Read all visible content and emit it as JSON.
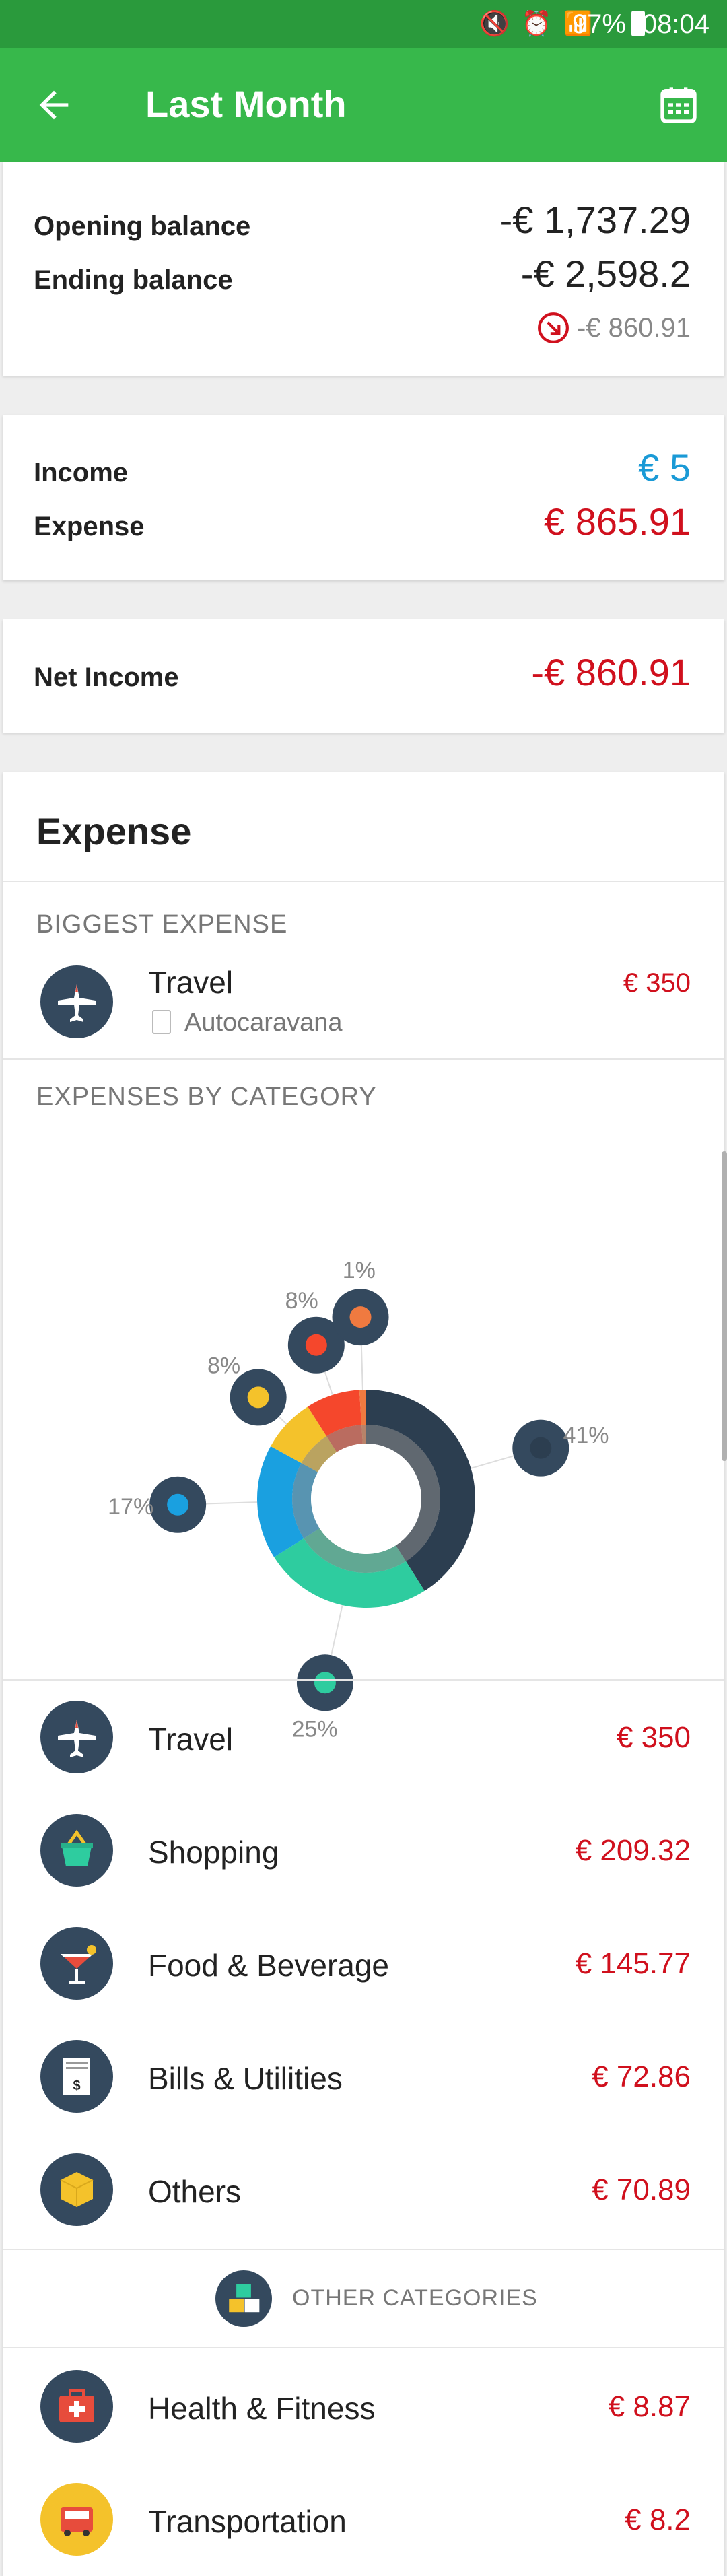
{
  "status_bar": {
    "battery": "97%",
    "time": "08:04"
  },
  "header": {
    "title": "Last Month"
  },
  "balance": {
    "opening_label": "Opening balance",
    "opening_value": "-€ 1,737.29",
    "ending_label": "Ending balance",
    "ending_value": "-€ 2,598.2",
    "change_value": "-€ 860.91"
  },
  "totals": {
    "income_label": "Income",
    "income_value": "€ 5",
    "expense_label": "Expense",
    "expense_value": "€ 865.91"
  },
  "net": {
    "label": "Net Income",
    "value": "-€ 860.91"
  },
  "expense_section": {
    "title": "Expense",
    "biggest_caption": "BIGGEST EXPENSE",
    "biggest": {
      "name": "Travel",
      "note": "Autocaravana",
      "amount": "€ 350"
    },
    "by_category_caption": "EXPENSES BY CATEGORY"
  },
  "chart_data": {
    "type": "pie",
    "categories": [
      "Travel",
      "Shopping",
      "Food & Beverage",
      "Bills & Utilities",
      "Others",
      "Other categories"
    ],
    "values": [
      41,
      25,
      17,
      8,
      8,
      1
    ],
    "labels": [
      "41%",
      "25%",
      "17%",
      "8%",
      "8%",
      "1%"
    ],
    "colors": [
      "#2c3e50",
      "#2ecc9f",
      "#1aa0e0",
      "#f4c22b",
      "#f5472c",
      "#f07a40"
    ]
  },
  "categories": [
    {
      "name": "Travel",
      "amount": "€ 350"
    },
    {
      "name": "Shopping",
      "amount": "€ 209.32"
    },
    {
      "name": "Food & Beverage",
      "amount": "€ 145.77"
    },
    {
      "name": "Bills & Utilities",
      "amount": "€ 72.86"
    },
    {
      "name": "Others",
      "amount": "€ 70.89"
    }
  ],
  "other_categories_caption": "OTHER CATEGORIES",
  "other_categories": [
    {
      "name": "Health & Fitness",
      "amount": "€ 8.87"
    },
    {
      "name": "Transportation",
      "amount": "€ 8.2"
    }
  ]
}
